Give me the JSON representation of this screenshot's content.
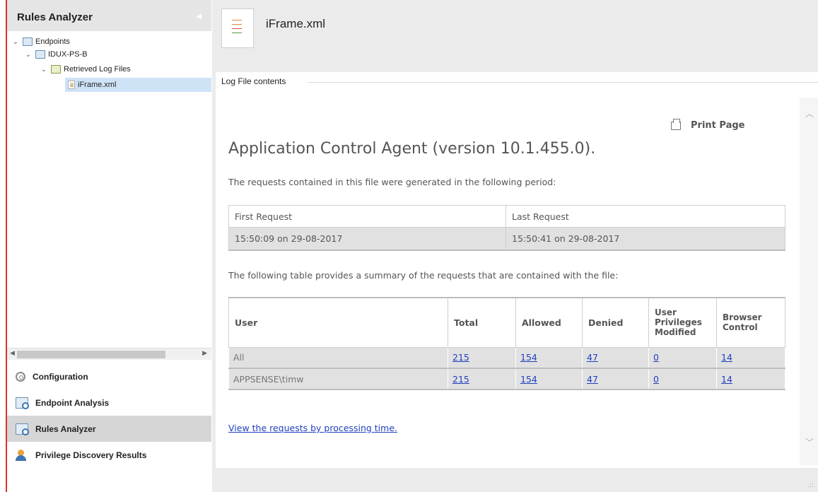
{
  "left": {
    "title": "Rules Analyzer",
    "tree": [
      {
        "label": "Endpoints"
      },
      {
        "label": "IDUX-PS-B"
      },
      {
        "label": "Retrieved Log Files"
      },
      {
        "label": "iFrame.xml"
      }
    ],
    "nav": [
      {
        "label": "Configuration",
        "icon": "gear-icon"
      },
      {
        "label": "Endpoint Analysis",
        "icon": "endpoint-analysis-icon"
      },
      {
        "label": "Rules Analyzer",
        "icon": "rules-analyzer-icon"
      },
      {
        "label": "Privilege Discovery Results",
        "icon": "privilege-discovery-icon"
      }
    ]
  },
  "header": {
    "file_title": "iFrame.xml"
  },
  "panel": {
    "group_label": "Log File contents",
    "print_label": "Print Page",
    "heading": "Application Control Agent (version 10.1.455.0).",
    "period_text": "The requests contained in this file were generated in the following period:",
    "period_table": {
      "headers": [
        "First Request",
        "Last Request"
      ],
      "values": [
        "15:50:09 on 29-08-2017",
        "15:50:41 on 29-08-2017"
      ]
    },
    "summary_text": "The following table provides a summary of the requests that are contained with the file:",
    "summary_table": {
      "headers": [
        "User",
        "Total",
        "Allowed",
        "Denied",
        "User Privileges Modified",
        "Browser Control"
      ],
      "rows": [
        [
          "All",
          "215",
          "154",
          "47",
          "0",
          "14"
        ],
        [
          "APPSENSE\\timw",
          "215",
          "154",
          "47",
          "0",
          "14"
        ]
      ]
    },
    "view_link": "View the requests by processing time."
  },
  "colors": {
    "accent_red": "#d9342b",
    "link_blue": "#1f3fbf",
    "selection": "#cfe3f7"
  }
}
